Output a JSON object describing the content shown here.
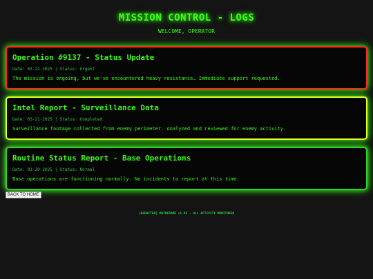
{
  "header": {
    "title": "MISSION CONTROL - LOGS",
    "subtitle": "WELCOME, OPERATOR"
  },
  "logs": [
    {
      "title": "Operation #9137 - Status Update",
      "date": "03-22-2025",
      "status": "Urgent",
      "meta": "Date: 03-22-2025 | Status: Urgent",
      "body": "The mission is ongoing, but we've encountered heavy resistance. Immediate support requested.",
      "border_color": "#ff2a1a"
    },
    {
      "title": "Intel Report - Surveillance Data",
      "date": "03-21-2025",
      "status": "Completed",
      "meta": "Date: 03-21-2025 | Status: Completed",
      "body": "Surveillance footage collected from enemy perimeter. Analyzed and reviewed for enemy activity.",
      "border_color": "#e8ff20"
    },
    {
      "title": "Routine Status Report - Base Operations",
      "date": "03-20-2025",
      "status": "Normal",
      "meta": "Date: 03-20-2025 | Status: Normal",
      "body": "Base operations are functioning normally. No incidents to report at this time.",
      "border_color": "#2fd02f"
    }
  ],
  "back_button": {
    "label": "BACK TO HOME"
  },
  "footer": {
    "text": "[REDACTED] MAINFRAME v1.03 - ALL ACTIVITY MONITORED"
  },
  "colors": {
    "background": "#141414",
    "accent": "#39ff14"
  }
}
